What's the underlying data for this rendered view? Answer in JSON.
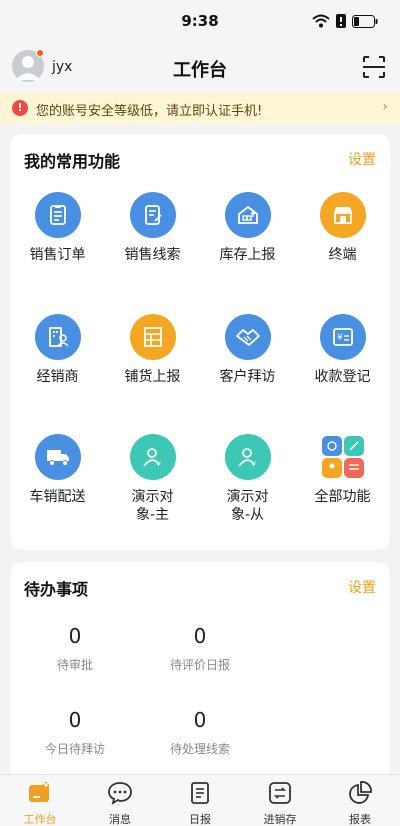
{
  "status": {
    "time": "9:38"
  },
  "header": {
    "username": "jyx",
    "title": "工作台"
  },
  "notice": {
    "text": "您的账号安全等级低，请立即认证手机!"
  },
  "favorites": {
    "title": "我的常用功能",
    "action": "设置",
    "items": [
      {
        "label": "销售订单",
        "icon": "clipboard-icon",
        "color": "#4a90e2"
      },
      {
        "label": "销售线索",
        "icon": "document-icon",
        "color": "#4a90e2"
      },
      {
        "label": "库存上报",
        "icon": "warehouse-icon",
        "color": "#4a90e2"
      },
      {
        "label": "终端",
        "icon": "store-icon",
        "color": "#f5a623"
      },
      {
        "label": "经销商",
        "icon": "dealer-icon",
        "color": "#4a90e2"
      },
      {
        "label": "铺货上报",
        "icon": "shelf-icon",
        "color": "#f5a623"
      },
      {
        "label": "客户拜访",
        "icon": "handshake-icon",
        "color": "#4a90e2"
      },
      {
        "label": "收款登记",
        "icon": "payment-icon",
        "color": "#4a90e2"
      },
      {
        "label": "车销配送",
        "icon": "truck-icon",
        "color": "#4a90e2"
      },
      {
        "label": "演示对象-主",
        "icon": "person-money-icon",
        "color": "#3cc8b4"
      },
      {
        "label": "演示对象-从",
        "icon": "person-money-icon",
        "color": "#3cc8b4"
      },
      {
        "label": "全部功能",
        "icon": "all-functions-icon",
        "color": "#ffffff"
      }
    ]
  },
  "todo": {
    "title": "待办事项",
    "action": "设置",
    "items": [
      {
        "count": "0",
        "label": "待审批"
      },
      {
        "count": "0",
        "label": "待评价日报"
      },
      {
        "count": "0",
        "label": "今日待拜访"
      },
      {
        "count": "0",
        "label": "待处理线索"
      }
    ]
  },
  "tabbar": [
    {
      "label": "工作台",
      "icon": "workbench-icon",
      "active": true
    },
    {
      "label": "消息",
      "icon": "message-icon",
      "active": false
    },
    {
      "label": "日报",
      "icon": "report-icon",
      "active": false
    },
    {
      "label": "进销存",
      "icon": "inventory-icon",
      "active": false
    },
    {
      "label": "报表",
      "icon": "pie-chart-icon",
      "active": false
    }
  ],
  "colors": {
    "accent": "#f0a020",
    "blue": "#4a90e2",
    "teal": "#3cc8b4",
    "orange": "#f5a623"
  }
}
